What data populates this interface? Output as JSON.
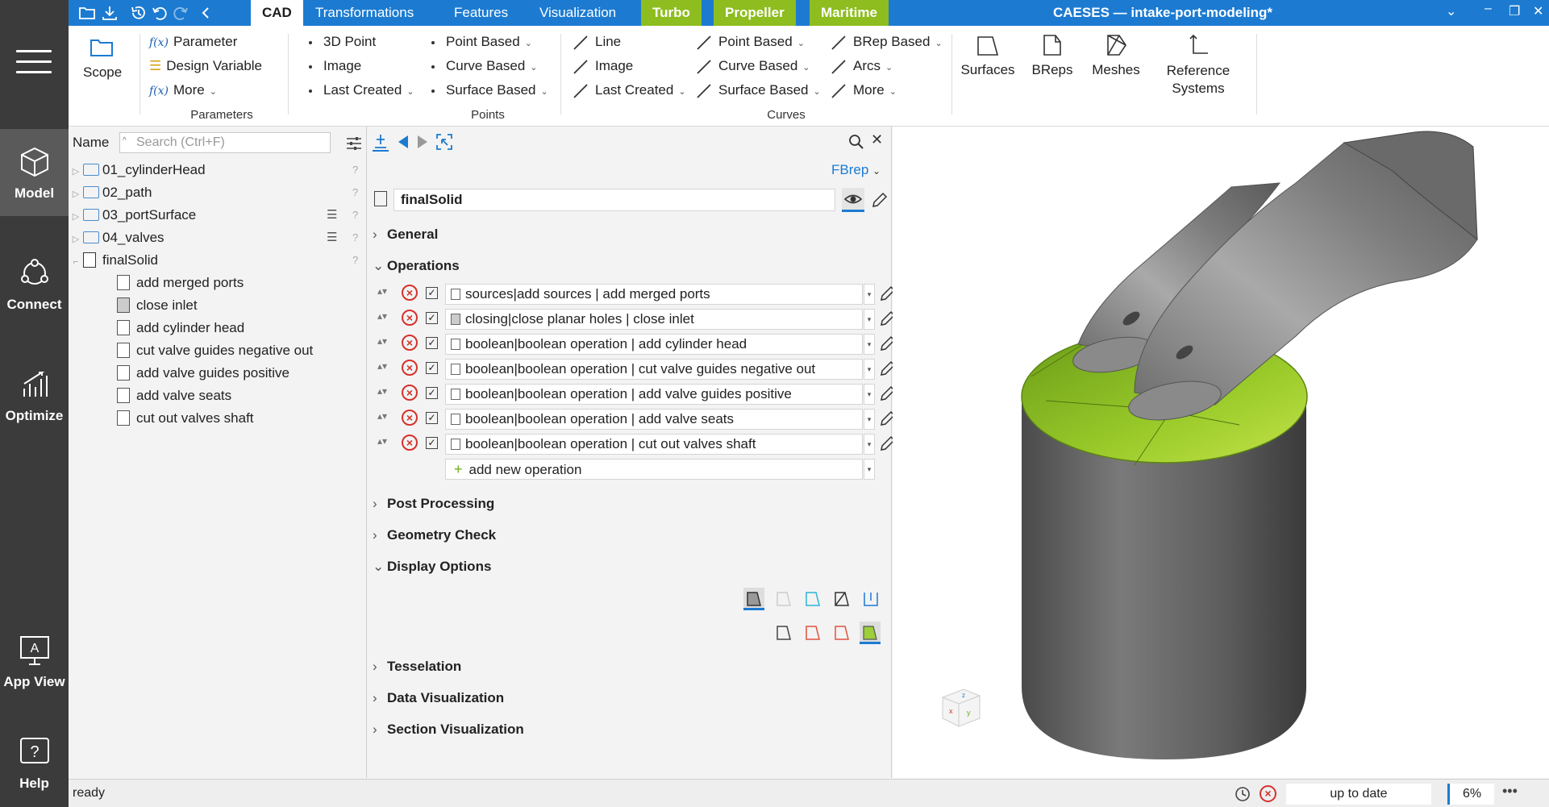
{
  "app_title": "CAESES — intake-port-modeling*",
  "left_nav": {
    "model": "Model",
    "connect": "Connect",
    "optimize": "Optimize",
    "app_view": "App View",
    "help": "Help"
  },
  "tabs": [
    "CAD",
    "Transformations",
    "Features",
    "Visualization",
    "Turbo",
    "Propeller",
    "Maritime"
  ],
  "ribbon": {
    "scope": "Scope",
    "parameters": {
      "items": [
        "Parameter",
        "Design Variable",
        "More"
      ],
      "group_label": "Parameters"
    },
    "points": {
      "col1": [
        "3D Point",
        "Image",
        "Last Created"
      ],
      "col2": [
        "Point Based",
        "Curve Based",
        "Surface Based"
      ],
      "group_label": "Points"
    },
    "curves": {
      "col1": [
        "Line",
        "Image",
        "Last Created"
      ],
      "col2": [
        "Point Based",
        "Curve Based",
        "Surface Based"
      ],
      "col3": [
        "BRep Based",
        "Arcs",
        "More"
      ],
      "group_label": "Curves"
    },
    "big_buttons": [
      "Surfaces",
      "BReps",
      "Meshes",
      "Reference",
      "Systems"
    ]
  },
  "tree": {
    "header_name": "Name",
    "search_placeholder": "Search (Ctrl+F)",
    "folders": [
      "01_cylinderHead",
      "02_path",
      "03_portSurface",
      "04_valves"
    ],
    "object": "finalSolid",
    "children": [
      "add merged ports",
      "close inlet",
      "add cylinder head",
      "cut valve guides negative out",
      "add valve guides positive",
      "add valve seats",
      "cut out valves shaft"
    ]
  },
  "properties": {
    "type_label": "FBrep",
    "object_name": "finalSolid",
    "sections": {
      "general": "General",
      "operations": "Operations",
      "post_processing": "Post Processing",
      "geometry_check": "Geometry Check",
      "display_options": "Display Options",
      "tesselation": "Tesselation",
      "data_visualization": "Data Visualization",
      "section_visualization": "Section Visualization"
    },
    "operations": [
      "sources|add sources | add merged ports",
      "closing|close planar holes | close inlet",
      "boolean|boolean operation | add cylinder head",
      "boolean|boolean operation | cut valve guides negative out",
      "boolean|boolean operation | add valve guides positive",
      "boolean|boolean operation | add valve seats",
      "boolean|boolean operation | cut out valves shaft"
    ],
    "add_new": "add new operation"
  },
  "status": {
    "ready": "ready",
    "state": "up to date",
    "zoom": "6%"
  },
  "colors": {
    "accent": "#1c7bd1",
    "green_tab": "#8dbd1e",
    "nav_bg": "#3b3b3b",
    "delete_red": "#d6312b",
    "model_green": "#7fb61c"
  }
}
